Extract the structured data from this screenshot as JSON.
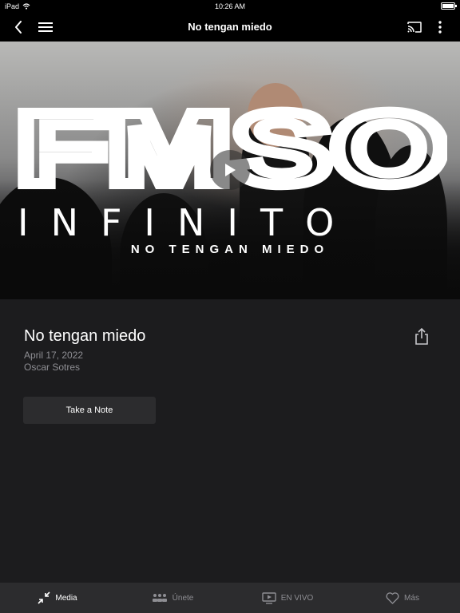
{
  "status_bar": {
    "device": "iPad",
    "time": "10:26 AM"
  },
  "nav": {
    "title": "No tengan miedo"
  },
  "hero": {
    "brand_text": "FMSO",
    "line2": "INFINITO",
    "line3": "NO TENGAN MIEDO"
  },
  "sermon": {
    "title": "No tengan miedo",
    "date": "April 17, 2022",
    "speaker": "Oscar Sotres"
  },
  "actions": {
    "note_label": "Take a Note"
  },
  "tabs": [
    {
      "label": "Media",
      "icon": "compress-icon",
      "active": true
    },
    {
      "label": "Únete",
      "icon": "group-icon",
      "active": false
    },
    {
      "label": "EN VIVO",
      "icon": "tv-play-icon",
      "active": false
    },
    {
      "label": "Más",
      "icon": "heart-icon",
      "active": false
    }
  ],
  "colors": {
    "background": "#1c1c1e",
    "bar": "#000000",
    "tab_bar": "#2c2c2e",
    "muted": "#8e8e93",
    "button": "#2c2c2e"
  }
}
